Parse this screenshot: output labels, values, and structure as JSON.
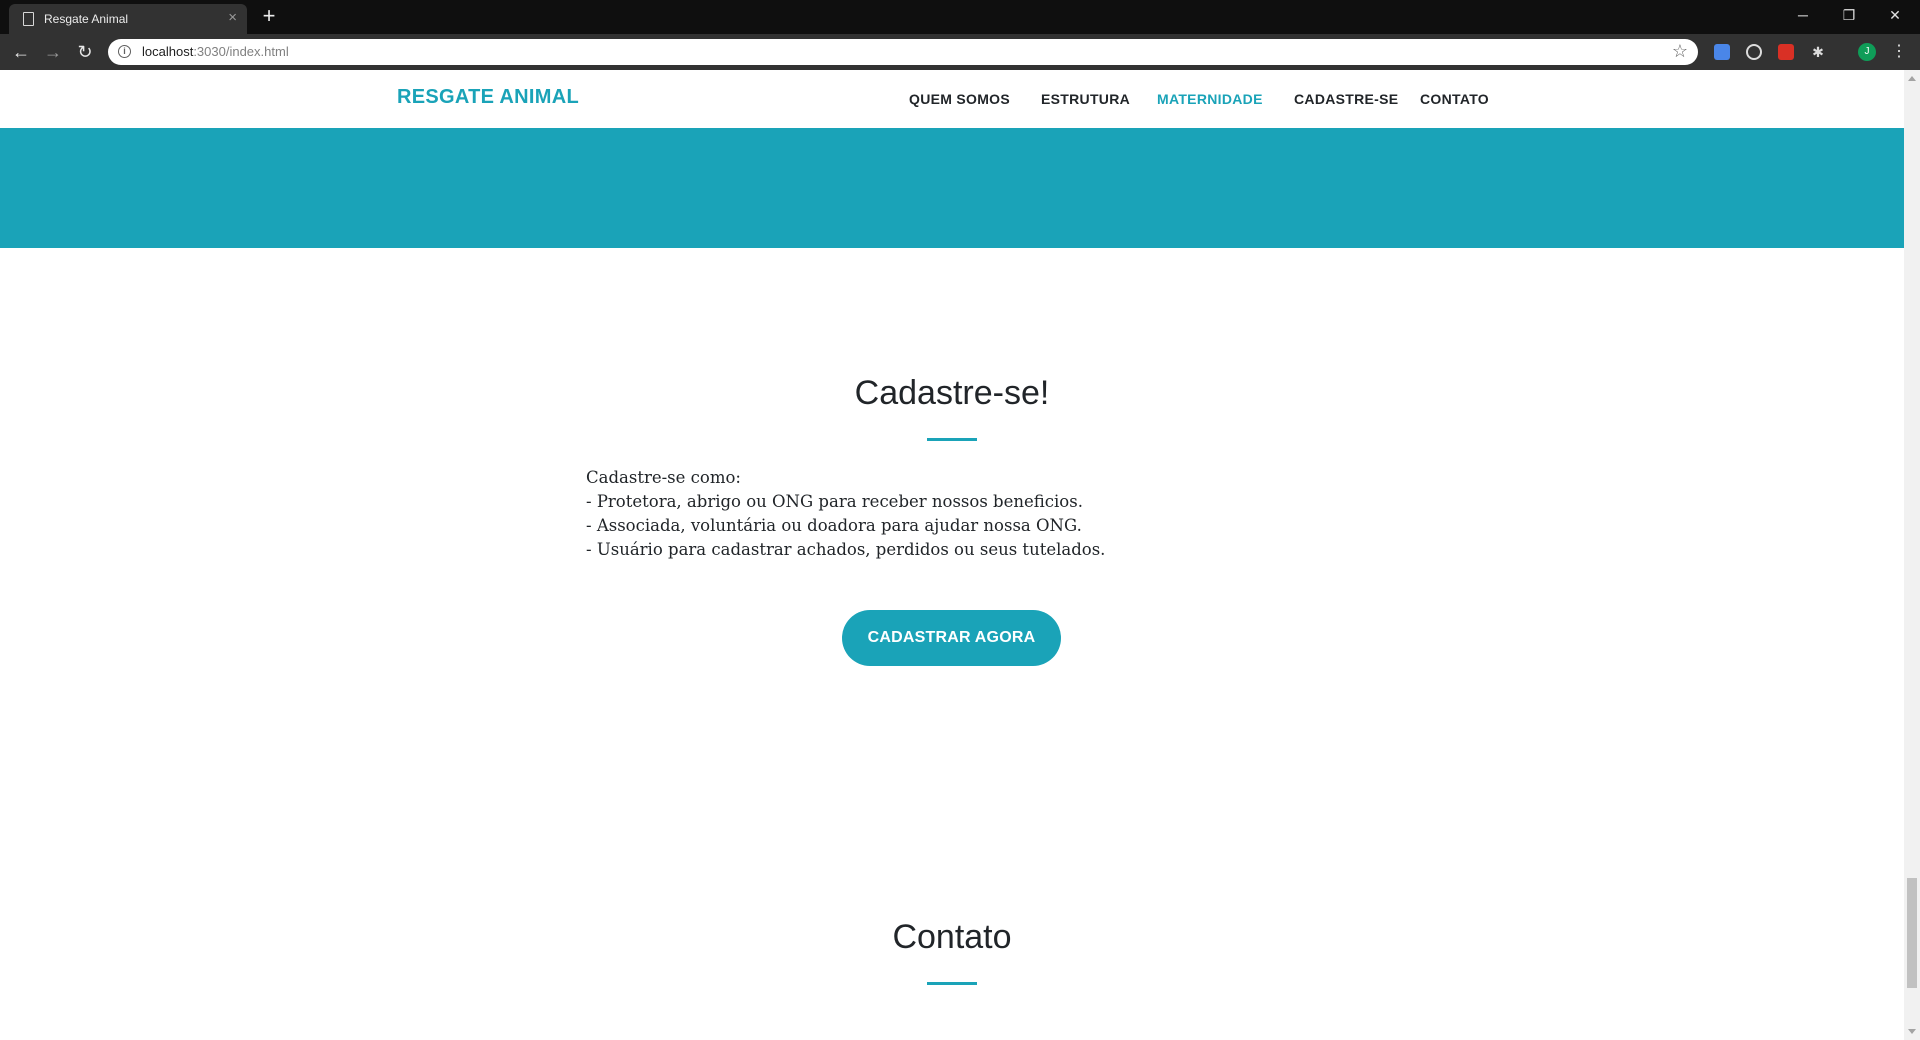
{
  "browser": {
    "tab_title": "Resgate Animal",
    "tab_close": "×",
    "new_tab": "+",
    "url_host": "localhost",
    "url_path": ":3030/index.html",
    "win_minimize": "─",
    "win_restore": "❐",
    "win_close": "✕",
    "back": "←",
    "forward": "→",
    "reload": "↻",
    "star": "☆",
    "profile_initial": "J",
    "menu": "⋮"
  },
  "site": {
    "brand": "RESGATE ANIMAL",
    "nav": [
      {
        "label": "QUEM SOMOS"
      },
      {
        "label": "ESTRUTURA"
      },
      {
        "label": "MATERNIDADE",
        "active": true
      },
      {
        "label": "CADASTRE-SE"
      },
      {
        "label": "CONTATO"
      }
    ]
  },
  "signup": {
    "title": "Cadastre-se!",
    "lines": [
      "Cadastre-se como:",
      "- Protetora, abrigo ou ONG para receber nossos beneficios.",
      "- Associada, voluntária ou doadora para ajudar nossa ONG.",
      "- Usuário para cadastrar achados, perdidos ou seus tutelados."
    ],
    "button_label": "CADASTRAR AGORA"
  },
  "contact": {
    "title": "Contato"
  },
  "colors": {
    "accent": "#1aa3b8",
    "text": "#212529",
    "chrome_dark": "#0f0f0f",
    "chrome_toolbar": "#323232"
  }
}
